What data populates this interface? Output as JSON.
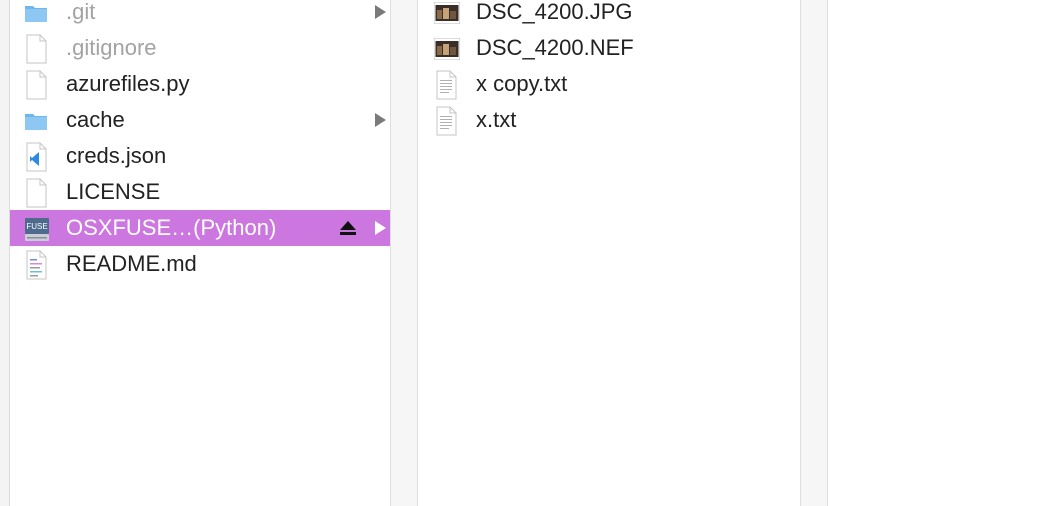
{
  "column1": {
    "items": [
      {
        "name": ".git",
        "icon": "folder-icon",
        "dim": true,
        "has_children": true
      },
      {
        "name": ".gitignore",
        "icon": "document-icon",
        "dim": true,
        "has_children": false
      },
      {
        "name": "azurefiles.py",
        "icon": "document-icon",
        "dim": false,
        "has_children": false
      },
      {
        "name": "cache",
        "icon": "folder-icon",
        "dim": false,
        "has_children": true
      },
      {
        "name": "creds.json",
        "icon": "vscode-document-icon",
        "dim": false,
        "has_children": false
      },
      {
        "name": "LICENSE",
        "icon": "document-icon",
        "dim": false,
        "has_children": false
      },
      {
        "name": "OSXFUSE…(Python)",
        "icon": "fuse-drive-icon",
        "icon_text": "FUSE",
        "dim": false,
        "has_children": true,
        "selected": true,
        "ejectable": true
      },
      {
        "name": "README.md",
        "icon": "text-document-icon",
        "dim": false,
        "has_children": false
      }
    ]
  },
  "column2": {
    "items": [
      {
        "name": "DSC_4200.JPG",
        "icon": "image-thumbnail-icon"
      },
      {
        "name": "DSC_4200.NEF",
        "icon": "image-thumbnail-icon"
      },
      {
        "name": "x copy.txt",
        "icon": "text-document-icon"
      },
      {
        "name": "x.txt",
        "icon": "text-document-icon"
      }
    ]
  },
  "colors": {
    "selection": "#cc77e0",
    "folder": "#6cb7ee",
    "dim_text": "#a3a3a3"
  }
}
